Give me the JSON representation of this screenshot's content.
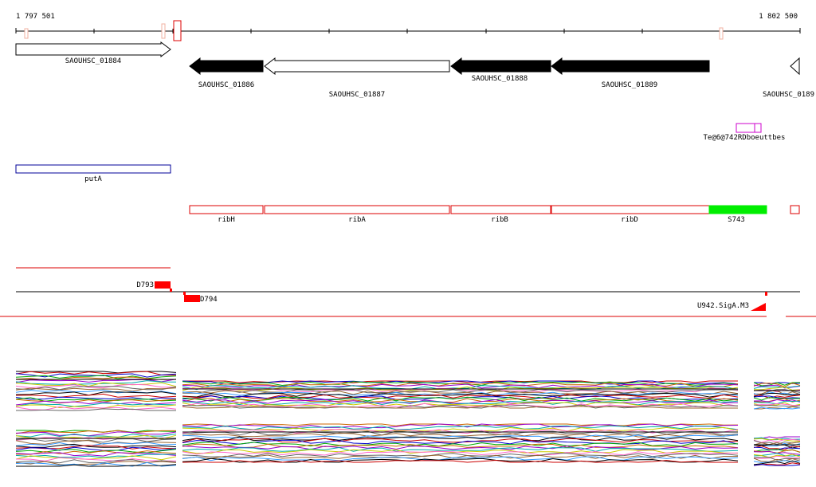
{
  "coords": {
    "start_label": "1 797 501",
    "end_label": "1 802 500"
  },
  "genes": [
    {
      "label": "SAOUHSC_01884",
      "strand": "+",
      "fill": "#ffffff"
    },
    {
      "label": "SAOUHSC_01886",
      "strand": "-",
      "fill": "#000000"
    },
    {
      "label": "SAOUHSC_01887",
      "strand": "-",
      "fill": "#ffffff"
    },
    {
      "label": "SAOUHSC_01888",
      "strand": "-",
      "fill": "#000000"
    },
    {
      "label": "SAOUHSC_01889",
      "strand": "-",
      "fill": "#000000"
    },
    {
      "label": "SAOUHSC_0189",
      "strand": "-",
      "fill": "#ffffff"
    }
  ],
  "magenta_feature": {
    "label": "Te@6@742RDboeuttbes",
    "color": "#cc00cc"
  },
  "blue_feature": {
    "label": "putA",
    "color": "#000099"
  },
  "red_features": [
    {
      "label": "ribH",
      "filled": false
    },
    {
      "label": "ribA",
      "filled": false
    },
    {
      "label": "ribB",
      "filled": false
    },
    {
      "label": "ribD",
      "filled": false
    },
    {
      "label": "S743",
      "filled": true,
      "color": "#00ee00"
    },
    {
      "label": "",
      "filled": false
    }
  ],
  "segments": [
    {
      "label": "D793"
    },
    {
      "label": "D794"
    },
    {
      "label": "U942.SigA.M3"
    }
  ],
  "colors": {
    "red": "#dd0000",
    "segment_red": "#ff0000",
    "axis": "#000000",
    "profile_palette": [
      "#000000",
      "#cc0000",
      "#0000cc",
      "#00aa00",
      "#cc6600",
      "#9900cc",
      "#00aaaa",
      "#cccc00",
      "#ff66cc",
      "#666666",
      "#996633",
      "#3399ff"
    ]
  }
}
